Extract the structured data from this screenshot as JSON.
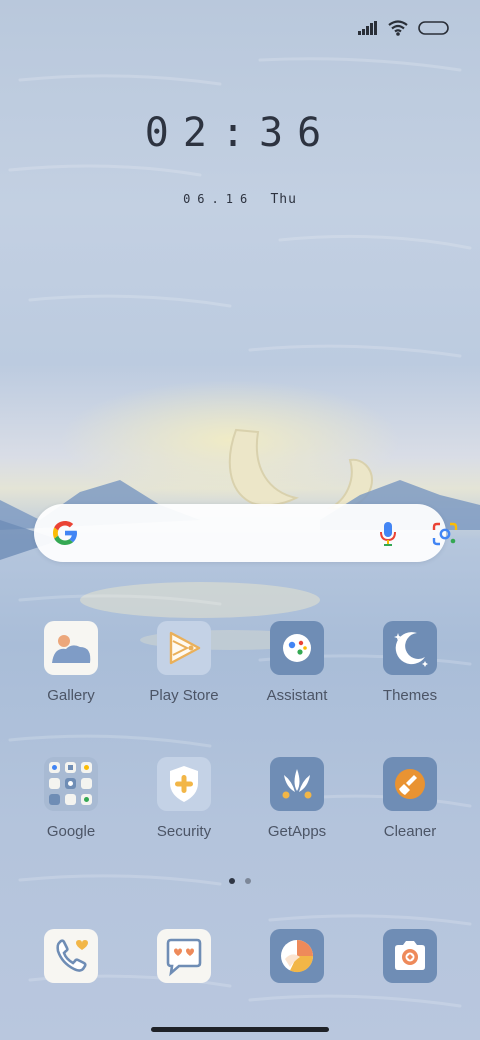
{
  "status_bar": {
    "icons": [
      "signal-icon",
      "wifi-icon",
      "battery-icon"
    ]
  },
  "clock": {
    "time": "02:36",
    "date": "06.16",
    "day": "Thu"
  },
  "search_bar": {
    "icons": [
      "google-logo-icon",
      "microphone-icon",
      "google-lens-icon"
    ]
  },
  "home_apps": [
    {
      "label": "Gallery",
      "icon": "gallery-icon"
    },
    {
      "label": "Play Store",
      "icon": "play-store-icon"
    },
    {
      "label": "Assistant",
      "icon": "assistant-icon"
    },
    {
      "label": "Themes",
      "icon": "themes-icon"
    },
    {
      "label": "Google",
      "icon": "google-folder-icon"
    },
    {
      "label": "Security",
      "icon": "security-icon"
    },
    {
      "label": "GetApps",
      "icon": "getapps-icon"
    },
    {
      "label": "Cleaner",
      "icon": "cleaner-icon"
    }
  ],
  "page_indicator": {
    "pages": 2,
    "current": 1
  },
  "dock": [
    {
      "icon": "phone-icon"
    },
    {
      "icon": "messages-icon"
    },
    {
      "icon": "browser-icon"
    },
    {
      "icon": "camera-icon"
    }
  ],
  "colors": {
    "accent_blue": "#6f8db5",
    "text_dark": "#2d3340",
    "label_text": "#4c5566"
  }
}
